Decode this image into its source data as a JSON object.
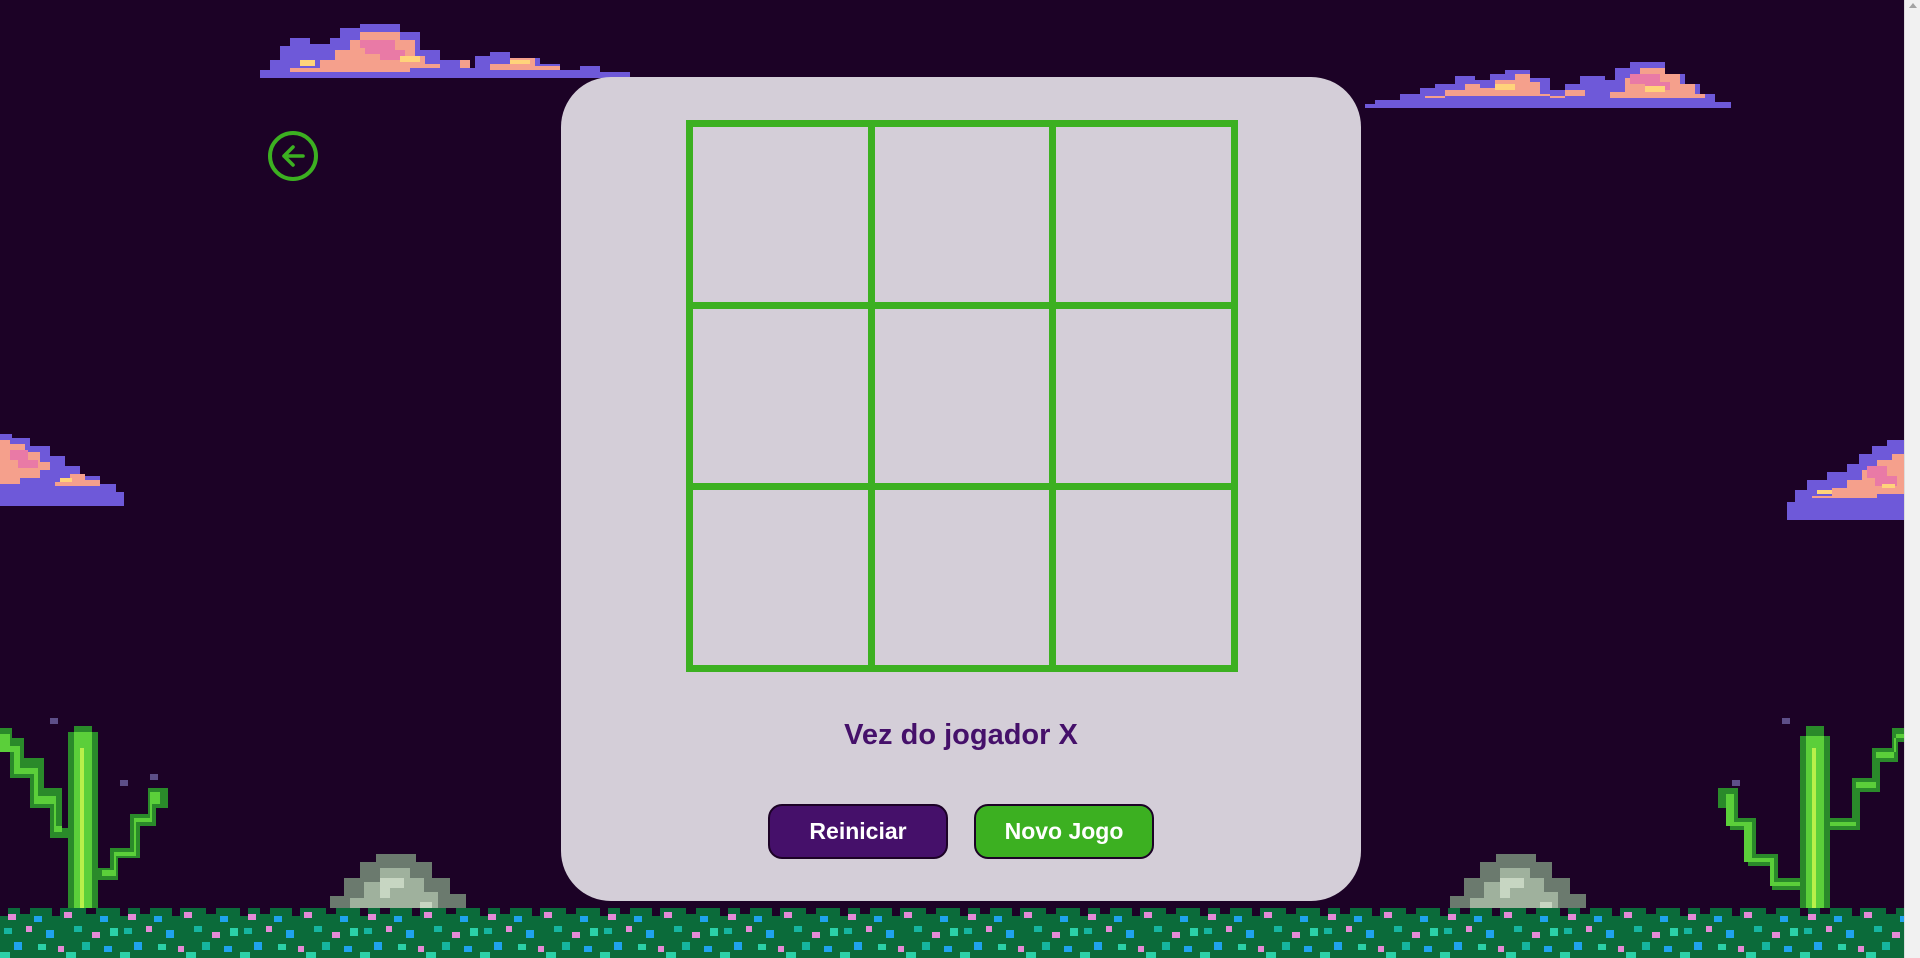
{
  "game": {
    "status_text": "Vez do jogador X",
    "board": [
      "",
      "",
      "",
      "",
      "",
      "",
      "",
      "",
      ""
    ]
  },
  "buttons": {
    "restart_label": "Reiniciar",
    "new_game_label": "Novo Jogo"
  },
  "icons": {
    "back": "arrow-left-circle-icon"
  },
  "colors": {
    "background": "#1c0226",
    "card": "#d4ced8",
    "accent_green": "#3cb021",
    "accent_purple": "#45106a",
    "button_text": "#ffffff"
  }
}
